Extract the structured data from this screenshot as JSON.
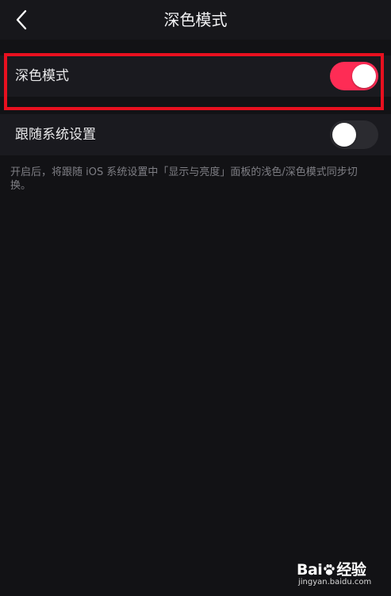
{
  "navbar": {
    "title": "深色模式",
    "back_icon": "chevron-left-icon"
  },
  "settings": {
    "dark_mode": {
      "label": "深色模式",
      "enabled": true
    },
    "follow_system": {
      "label": "跟随系统设置",
      "enabled": false
    },
    "description": "开启后，将跟随 iOS 系统设置中「显示与亮度」面板的浅色/深色模式同步切换。"
  },
  "colors": {
    "accent": "#fe2c55",
    "highlight": "#e8101f",
    "background": "#121215"
  },
  "watermark": {
    "logo_left": "Bai",
    "logo_right": "经验",
    "url": "jingyan.baidu.com"
  }
}
